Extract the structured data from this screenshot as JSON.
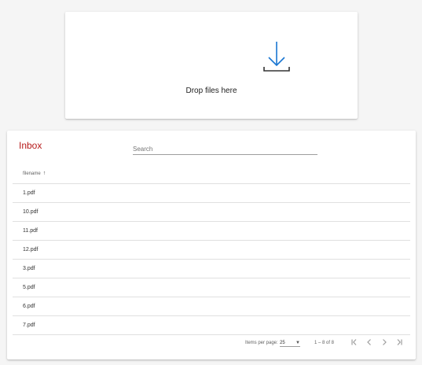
{
  "dropzone": {
    "label": "Drop files here",
    "icon": "download-icon"
  },
  "inbox": {
    "title": "Inbox",
    "search_placeholder": "Search",
    "columns": [
      {
        "label": "filename",
        "sort": "ascending"
      }
    ],
    "rows": [
      "1.pdf",
      "10.pdf",
      "11.pdf",
      "12.pdf",
      "3.pdf",
      "5.pdf",
      "6.pdf",
      "7.pdf"
    ],
    "paginator": {
      "items_per_page_label": "Items per page:",
      "items_per_page_value": "25",
      "range_label": "1 – 8 of 8"
    }
  },
  "colors": {
    "accent": "#1976d2",
    "title": "#b71c1c"
  }
}
